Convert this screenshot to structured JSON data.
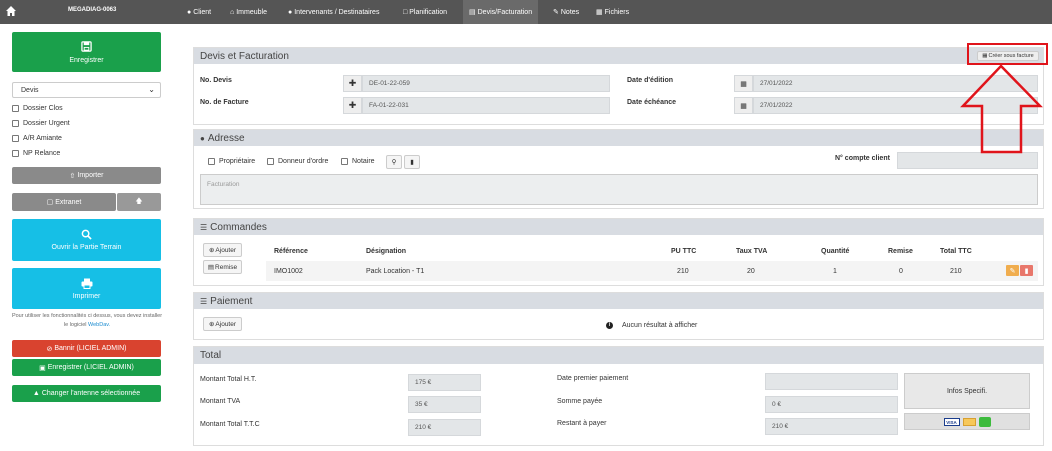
{
  "app": {
    "title": "MEGADIAG-0063"
  },
  "nav": {
    "client": "Client",
    "immeuble": "Immeuble",
    "intervenants": "Intervenants / Destinataires",
    "planification": "Planification",
    "devis": "Devis/Facturation",
    "notes": "Notes",
    "fichiers": "Fichiers"
  },
  "sidebar": {
    "save": "Enregistrer",
    "select_value": "Devis",
    "checks": [
      "Dossier Clos",
      "Dossier Urgent",
      "A/R Amiante",
      "NP Relance"
    ],
    "import": "Importer",
    "extranet": "Extranet",
    "open_field": "Ouvrir la Partie Terrain",
    "print": "Imprimer",
    "note": "Pour utiliser les fonctionnalités ci dessus, vous devez installer le logiciel",
    "webdav": "WebDav.",
    "ban": "Bannir (LICIEL ADMIN)",
    "save_admin": "Enregistrer (LICIEL ADMIN)",
    "change_antenna": "Changer l'antenne sélectionnée"
  },
  "devis": {
    "title": "Devis et Facturation",
    "create_invoice": "Créer sous facture",
    "no_devis_label": "No. Devis",
    "no_devis_value": "DE-01-22-059",
    "no_facture_label": "No. de Facture",
    "no_facture_value": "FA-01-22-031",
    "date_edition_label": "Date d'édition",
    "date_edition_value": "27/01/2022",
    "date_echeance_label": "Date échéance",
    "date_echeance_value": "27/01/2022"
  },
  "adresse": {
    "title": "Adresse",
    "checks": [
      "Propriétaire",
      "Donneur d'ordre",
      "Notaire"
    ],
    "compte_label": "N° compte client",
    "placeholder": "Facturation"
  },
  "commandes": {
    "title": "Commandes",
    "add": "Ajouter",
    "discount": "Remise",
    "headers": [
      "Référence",
      "Désignation",
      "PU TTC",
      "Taux TVA",
      "Quantité",
      "Remise",
      "Total TTC"
    ],
    "rows": [
      [
        "IMO1002",
        "Pack Location - T1",
        "210",
        "20",
        "1",
        "0",
        "210"
      ]
    ]
  },
  "paiement": {
    "title": "Paiement",
    "add": "Ajouter",
    "empty": "Aucun résultat à afficher"
  },
  "total": {
    "title": "Total",
    "ht_label": "Montant Total H.T.",
    "ht_value": "175 €",
    "tva_label": "Montant TVA",
    "tva_value": "35 €",
    "ttc_label": "Montant Total T.T.C",
    "ttc_value": "210 €",
    "first_pay_label": "Date premier paiement",
    "first_pay_value": "",
    "paid_label": "Somme payée",
    "paid_value": "0 €",
    "remaining_label": "Restant à payer",
    "remaining_value": "210 €",
    "infos": "Infos Specifi.",
    "visa": "VISA"
  },
  "colors": {
    "green": "#1aa04b",
    "cyan": "#16bfe6",
    "red": "#d9432f",
    "annotation": "#e0141b"
  }
}
